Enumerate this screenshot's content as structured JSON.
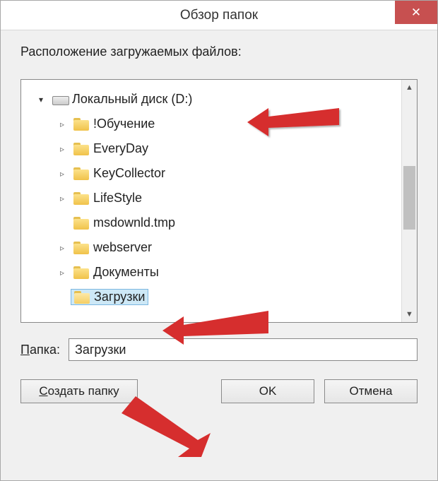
{
  "title": "Обзор папок",
  "close_symbol": "✕",
  "prompt": "Расположение загружаемых файлов:",
  "tree": {
    "root": {
      "label": "Локальный диск (D:)",
      "expanded": true,
      "icon": "drive"
    },
    "items": [
      {
        "label": "!Обучение",
        "expandable": true,
        "icon": "folder"
      },
      {
        "label": "EveryDay",
        "expandable": true,
        "icon": "folder"
      },
      {
        "label": "KeyCollector",
        "expandable": true,
        "icon": "folder"
      },
      {
        "label": "LifeStyle",
        "expandable": true,
        "icon": "folder"
      },
      {
        "label": "msdownld.tmp",
        "expandable": false,
        "icon": "folder"
      },
      {
        "label": "webserver",
        "expandable": true,
        "icon": "folder"
      },
      {
        "label": "Документы",
        "expandable": true,
        "icon": "folder"
      },
      {
        "label": "Загрузки",
        "expandable": false,
        "icon": "folder-open",
        "selected": true
      }
    ]
  },
  "folder_field": {
    "label": "Папка:",
    "value": "Загрузки"
  },
  "buttons": {
    "new_folder": "Создать папку",
    "ok": "OK",
    "cancel": "Отмена"
  },
  "scroll": {
    "up": "▲",
    "down": "▼"
  }
}
